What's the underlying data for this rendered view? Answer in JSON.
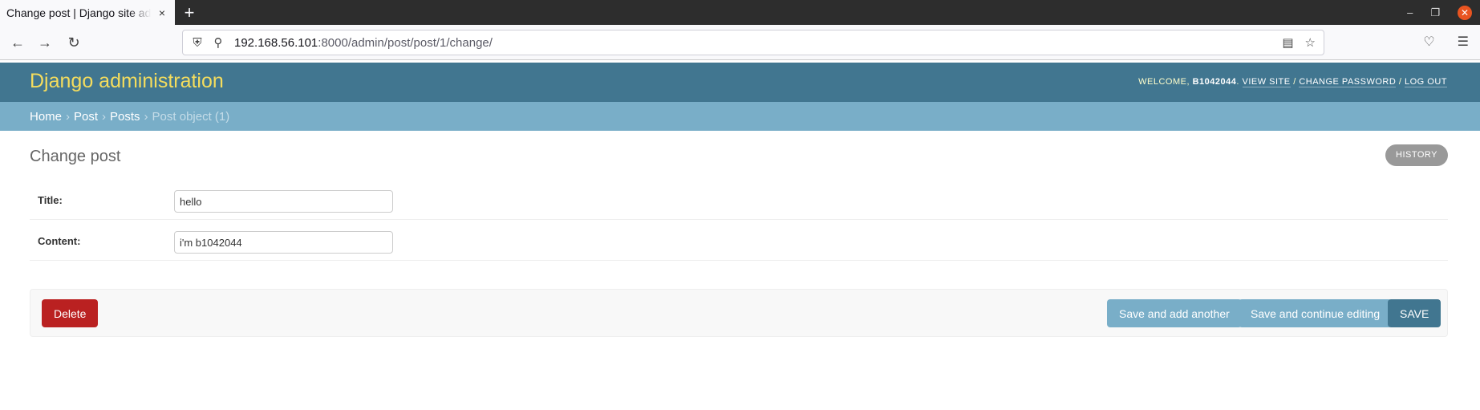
{
  "browser": {
    "tab_title": "Change post | Django site ad",
    "tab_close": "×",
    "new_tab": "+",
    "url_host": "192.168.56.101",
    "url_rest": ":8000/admin/post/post/1/change/"
  },
  "header": {
    "branding": "Django administration",
    "welcome": "Welcome,",
    "username": "B1042044",
    "view_site": "View site",
    "change_password": "Change password",
    "log_out": "Log out",
    "separator": "/"
  },
  "breadcrumbs": {
    "home": "Home",
    "app": "Post",
    "model": "Posts",
    "current": "Post object (1)",
    "separator": "›"
  },
  "page": {
    "title": "Change post",
    "history_label": "HISTORY"
  },
  "form": {
    "title_label": "Title:",
    "title_value": "hello",
    "content_label": "Content:",
    "content_value": "i'm b1042044"
  },
  "actions": {
    "delete_label": "Delete",
    "save_add_another_label": "Save and add another",
    "save_continue_label": "Save and continue editing",
    "save_label": "SAVE"
  },
  "colors": {
    "header_bg": "#417690",
    "breadcrumb_bg": "#79aec8",
    "branding": "#f5dd5d",
    "delete": "#ba2121"
  }
}
